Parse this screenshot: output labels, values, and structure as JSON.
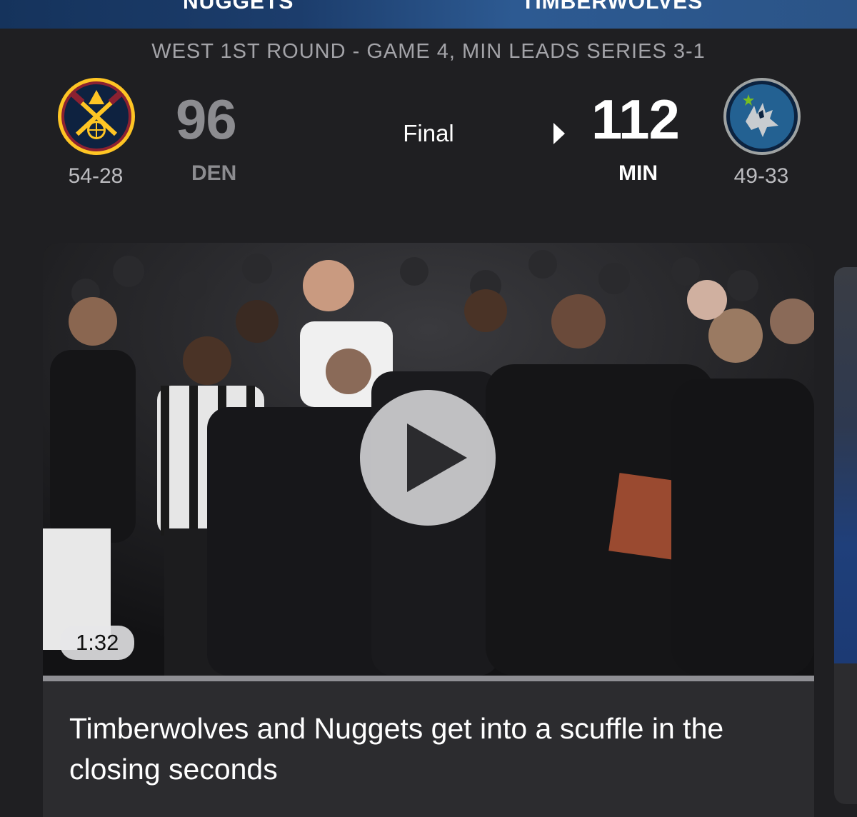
{
  "banner": {
    "left_team": "NUGGETS",
    "right_team": "TIMBERWOLVES"
  },
  "game": {
    "series_text": "WEST 1ST ROUND - GAME 4, MIN LEADS SERIES 3-1",
    "status": "Final",
    "away": {
      "abbr": "DEN",
      "score": "96",
      "record": "54-28",
      "logo_icon": "nuggets-logo-icon",
      "colors": {
        "primary": "#0E2240",
        "accent": "#FEC524",
        "secondary": "#8B2131"
      }
    },
    "home": {
      "abbr": "MIN",
      "score": "112",
      "record": "49-33",
      "logo_icon": "timberwolves-logo-icon",
      "colors": {
        "primary": "#0C2340",
        "accent": "#236192",
        "secondary": "#78BE20"
      },
      "winner": true
    }
  },
  "video": {
    "duration": "1:32",
    "headline": "Timberwolves and Nuggets get into a scuffle in the closing seconds",
    "progress_fraction": 1.0,
    "play_icon": "play-icon"
  }
}
